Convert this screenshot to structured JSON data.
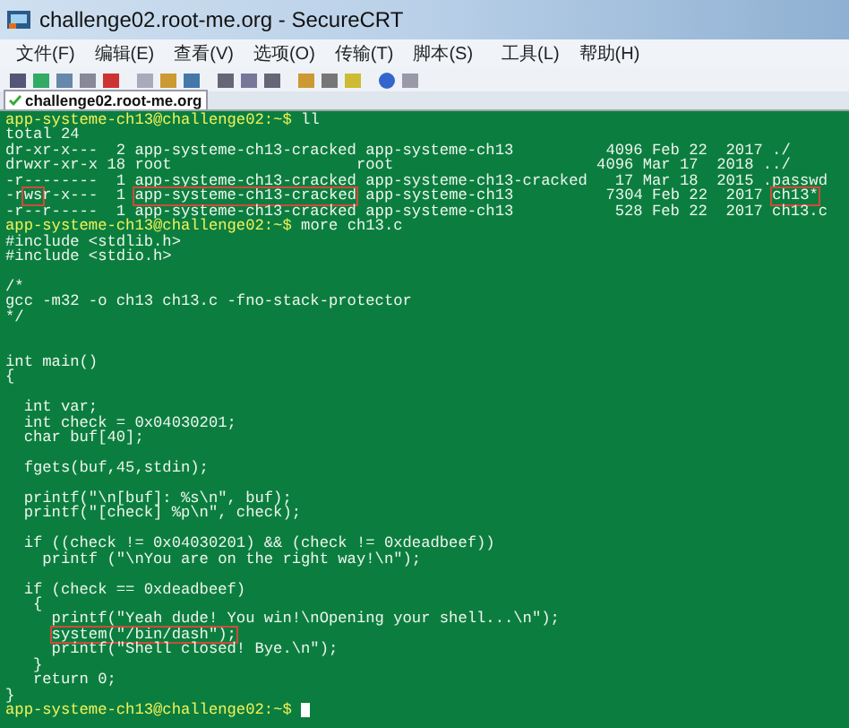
{
  "window": {
    "title": "challenge02.root-me.org - SecureCRT"
  },
  "menu": [
    "文件(F)",
    "编辑(E)",
    "查看(V)",
    "选项(O)",
    "传输(T)",
    "脚本(S)",
    "工具(L)",
    "帮助(H)"
  ],
  "tabs": [
    {
      "label": "challenge02.root-me.org",
      "selected": true,
      "connected": true
    }
  ],
  "terminal": {
    "cursor_visible": true,
    "lines": [
      {
        "kind": "text",
        "segments": [
          {
            "text": "app-systeme-ch13@challenge02:~$ ",
            "kind": "prompt",
            "boxed": false
          },
          {
            "text": "ll",
            "kind": "plain",
            "boxed": false
          }
        ]
      },
      {
        "kind": "text",
        "segments": [
          {
            "text": "total 24",
            "kind": "plain",
            "boxed": false
          }
        ]
      },
      {
        "kind": "text",
        "segments": [
          {
            "text": "dr-xr-x---  2 app-systeme-ch13-cracked app-systeme-ch13          4096 Feb 22  2017 ./",
            "kind": "plain",
            "boxed": false
          }
        ]
      },
      {
        "kind": "text",
        "segments": [
          {
            "text": "drwxr-xr-x 18 root                    root                      4096 Mar 17  2018 ../",
            "kind": "plain",
            "boxed": false
          }
        ]
      },
      {
        "kind": "text",
        "segments": [
          {
            "text": "-r--------  1 app-systeme-ch13-cracked app-systeme-ch13-cracked   17 Mar 18  2015 .passwd",
            "kind": "plain",
            "boxed": false
          }
        ]
      },
      {
        "kind": "text",
        "segments": [
          {
            "text": "-r",
            "kind": "plain",
            "boxed": false
          },
          {
            "text": "ws",
            "kind": "plain",
            "boxed": true
          },
          {
            "text": "r-x---  1 ",
            "kind": "plain",
            "boxed": false
          },
          {
            "text": "app-systeme-ch13-cracked",
            "kind": "plain",
            "boxed": true
          },
          {
            "text": " app-systeme-ch13          7304 Feb 22  2017 ",
            "kind": "plain",
            "boxed": false
          },
          {
            "text": "ch13*",
            "kind": "plain",
            "boxed": true
          }
        ]
      },
      {
        "kind": "text",
        "segments": [
          {
            "text": "-r--r-----  1 app-systeme-ch13-cracked app-systeme-ch13           528 Feb 22  2017 ch13.c",
            "kind": "plain",
            "boxed": false
          }
        ]
      },
      {
        "kind": "text",
        "segments": [
          {
            "text": "app-systeme-ch13@challenge02:~$ ",
            "kind": "prompt",
            "boxed": false
          },
          {
            "text": "more ch13.c",
            "kind": "plain",
            "boxed": false
          }
        ]
      },
      {
        "kind": "text",
        "segments": [
          {
            "text": "#include <stdlib.h>",
            "kind": "plain",
            "boxed": false
          }
        ]
      },
      {
        "kind": "text",
        "segments": [
          {
            "text": "#include <stdio.h>",
            "kind": "plain",
            "boxed": false
          }
        ]
      },
      {
        "kind": "blank"
      },
      {
        "kind": "text",
        "segments": [
          {
            "text": "/*",
            "kind": "plain",
            "boxed": false
          }
        ]
      },
      {
        "kind": "text",
        "segments": [
          {
            "text": "gcc -m32 -o ch13 ch13.c -fno-stack-protector",
            "kind": "plain",
            "boxed": false
          }
        ]
      },
      {
        "kind": "text",
        "segments": [
          {
            "text": "*/",
            "kind": "plain",
            "boxed": false
          }
        ]
      },
      {
        "kind": "blank"
      },
      {
        "kind": "blank"
      },
      {
        "kind": "text",
        "segments": [
          {
            "text": "int main()",
            "kind": "plain",
            "boxed": false
          }
        ]
      },
      {
        "kind": "text",
        "segments": [
          {
            "text": "{",
            "kind": "plain",
            "boxed": false
          }
        ]
      },
      {
        "kind": "blank"
      },
      {
        "kind": "text",
        "segments": [
          {
            "text": "  int var;",
            "kind": "plain",
            "boxed": false
          }
        ]
      },
      {
        "kind": "text",
        "segments": [
          {
            "text": "  int check = 0x04030201;",
            "kind": "plain",
            "boxed": false
          }
        ]
      },
      {
        "kind": "text",
        "segments": [
          {
            "text": "  char buf[40];",
            "kind": "plain",
            "boxed": false
          }
        ]
      },
      {
        "kind": "blank"
      },
      {
        "kind": "text",
        "segments": [
          {
            "text": "  fgets(buf,45,stdin);",
            "kind": "plain",
            "boxed": false
          }
        ]
      },
      {
        "kind": "blank"
      },
      {
        "kind": "text",
        "segments": [
          {
            "text": "  printf(\"\\n[buf]: %s\\n\", buf);",
            "kind": "plain",
            "boxed": false
          }
        ]
      },
      {
        "kind": "text",
        "segments": [
          {
            "text": "  printf(\"[check] %p\\n\", check);",
            "kind": "plain",
            "boxed": false
          }
        ]
      },
      {
        "kind": "blank"
      },
      {
        "kind": "text",
        "segments": [
          {
            "text": "  if ((check != 0x04030201) && (check != 0xdeadbeef))",
            "kind": "plain",
            "boxed": false
          }
        ]
      },
      {
        "kind": "text",
        "segments": [
          {
            "text": "    printf (\"\\nYou are on the right way!\\n\");",
            "kind": "plain",
            "boxed": false
          }
        ]
      },
      {
        "kind": "blank"
      },
      {
        "kind": "text",
        "segments": [
          {
            "text": "  if (check == 0xdeadbeef)",
            "kind": "plain",
            "boxed": false
          }
        ]
      },
      {
        "kind": "text",
        "segments": [
          {
            "text": "   {",
            "kind": "plain",
            "boxed": false
          }
        ]
      },
      {
        "kind": "text",
        "segments": [
          {
            "text": "     printf(\"Yeah dude! You win!\\nOpening your shell...\\n\");",
            "kind": "plain",
            "boxed": false
          }
        ]
      },
      {
        "kind": "text",
        "segments": [
          {
            "text": "     system(\"/bin/dash\");",
            "kind": "plain",
            "boxed": true
          }
        ]
      },
      {
        "kind": "text",
        "segments": [
          {
            "text": "     printf(\"Shell closed! Bye.\\n\");",
            "kind": "plain",
            "boxed": false
          }
        ]
      },
      {
        "kind": "text",
        "segments": [
          {
            "text": "   }",
            "kind": "plain",
            "boxed": false
          }
        ]
      },
      {
        "kind": "text",
        "segments": [
          {
            "text": "   return 0;",
            "kind": "plain",
            "boxed": false
          }
        ]
      },
      {
        "kind": "text",
        "segments": [
          {
            "text": "}",
            "kind": "plain",
            "boxed": false
          }
        ]
      },
      {
        "kind": "text",
        "segments": [
          {
            "text": "app-systeme-ch13@challenge02:~$ ",
            "kind": "prompt",
            "boxed": false
          }
        ]
      }
    ]
  }
}
